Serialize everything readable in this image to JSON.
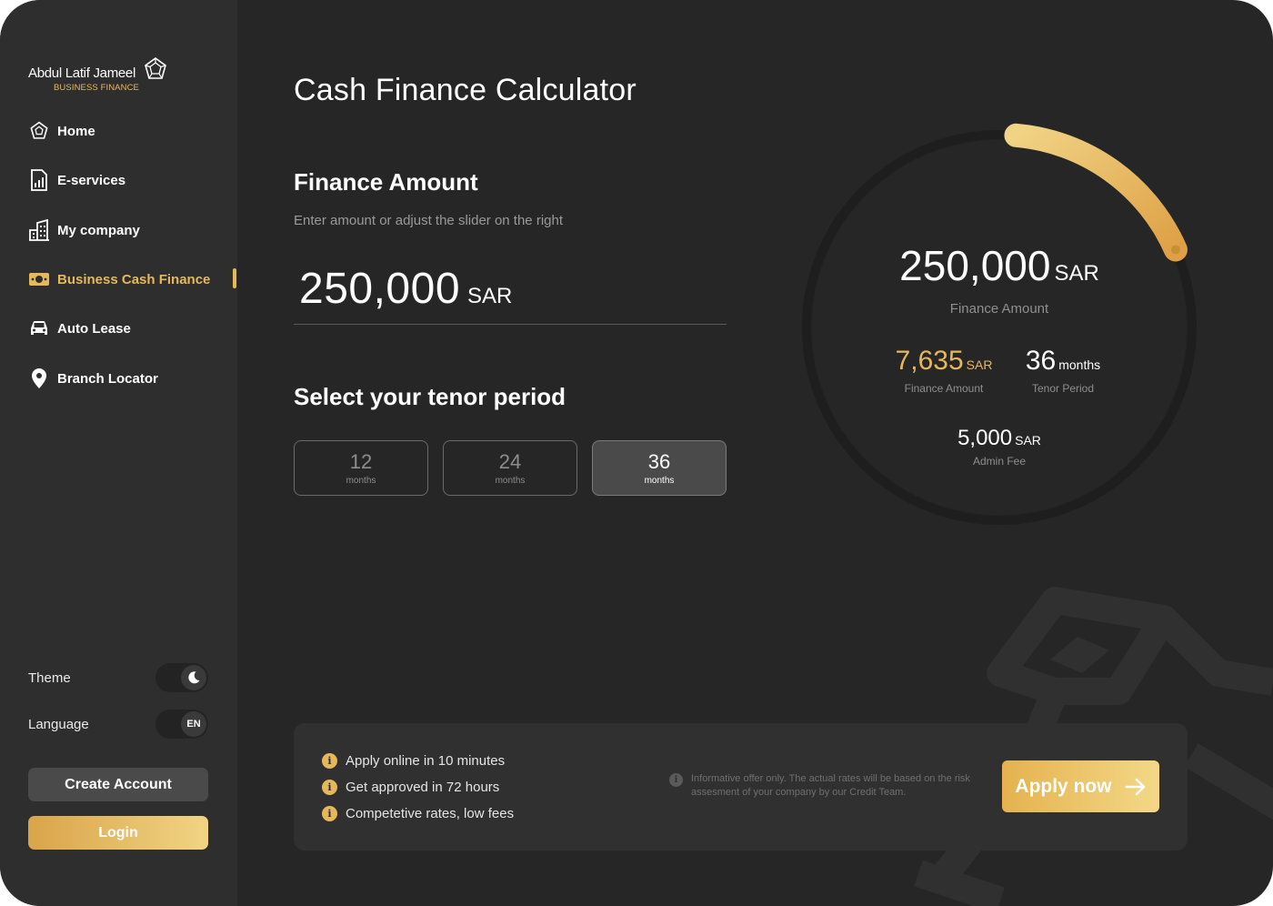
{
  "brand": {
    "name": "Abdul Latif Jameel",
    "subtitle": "BUSINESS FINANCE",
    "accent": "#e7b85a"
  },
  "sidebar": {
    "items": [
      {
        "label": "Home",
        "icon": "home-logo-icon"
      },
      {
        "label": "E-services",
        "icon": "document-chart-icon"
      },
      {
        "label": "My company",
        "icon": "buildings-icon"
      },
      {
        "label": "Business Cash Finance",
        "icon": "cash-icon",
        "active": true
      },
      {
        "label": "Auto Lease",
        "icon": "car-icon"
      },
      {
        "label": "Branch Locator",
        "icon": "location-pin-icon"
      }
    ],
    "theme_label": "Theme",
    "theme_icon": "moon-icon",
    "language_label": "Language",
    "language_value": "EN",
    "create_account_label": "Create Account",
    "login_label": "Login"
  },
  "main": {
    "title": "Cash Finance Calculator",
    "finance_section_title": "Finance Amount",
    "finance_hint": "Enter amount or adjust the slider on the right",
    "amount_value": "250,000",
    "amount_unit": "SAR",
    "tenor_title": "Select your tenor period",
    "tenors": [
      {
        "value": "12",
        "unit": "months",
        "selected": false
      },
      {
        "value": "24",
        "unit": "months",
        "selected": false
      },
      {
        "value": "36",
        "unit": "months",
        "selected": true
      }
    ]
  },
  "summary": {
    "amount_value": "250,000",
    "amount_unit": "SAR",
    "amount_label": "Finance Amount",
    "slider_fraction": 0.17,
    "monthly_value": "7,635",
    "monthly_unit": "SAR",
    "monthly_label": "Finance Amount",
    "tenor_value": "36",
    "tenor_unit": "months",
    "tenor_label": "Tenor Period",
    "fee_value": "5,000",
    "fee_unit": "SAR",
    "fee_label": "Admin Fee"
  },
  "footer": {
    "bullets": [
      "Apply online in 10 minutes",
      "Get approved in 72 hours",
      "Competetive rates, low fees"
    ],
    "bullet_icon": "info-icon",
    "disclaimer": "Informative offer only. The actual rates will be based on the risk assesment of your company by our Credit Team.",
    "apply_label": "Apply now",
    "apply_icon": "arrow-right-icon"
  }
}
